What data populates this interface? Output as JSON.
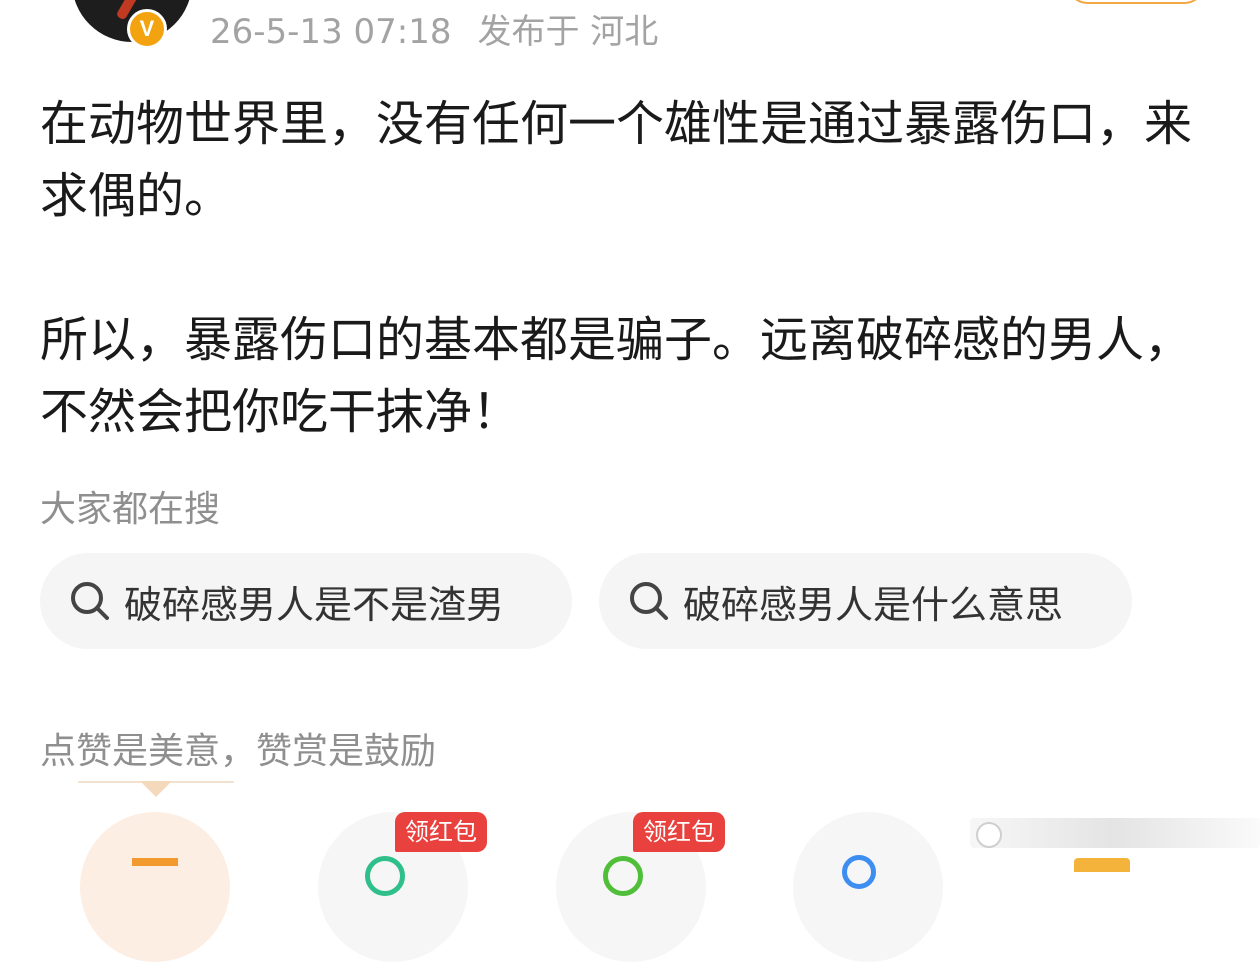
{
  "post": {
    "timestamp": "26-5-13 07:18",
    "location": "发布于 河北",
    "verified_badge": "V",
    "paragraphs": [
      "在动物世界里，没有任何一个雄性是通过暴露伤口，来求偶的。",
      "所以，暴露伤口的基本都是骗子。远离破碎感的男人，不然会把你吃干抹净！"
    ]
  },
  "search": {
    "title": "大家都在搜",
    "chips": [
      {
        "icon": "search-icon",
        "label": "破碎感男人是不是渣男"
      },
      {
        "icon": "search-icon",
        "label": "破碎感男人是什么意思"
      }
    ]
  },
  "reward": {
    "title": "点赞是美意，赞赏是鼓励",
    "badges": [
      "领红包",
      "领红包"
    ]
  },
  "colors": {
    "accent_orange": "#f3a744",
    "badge_red": "#e8413e",
    "verified_gold": "#f2a30f"
  }
}
